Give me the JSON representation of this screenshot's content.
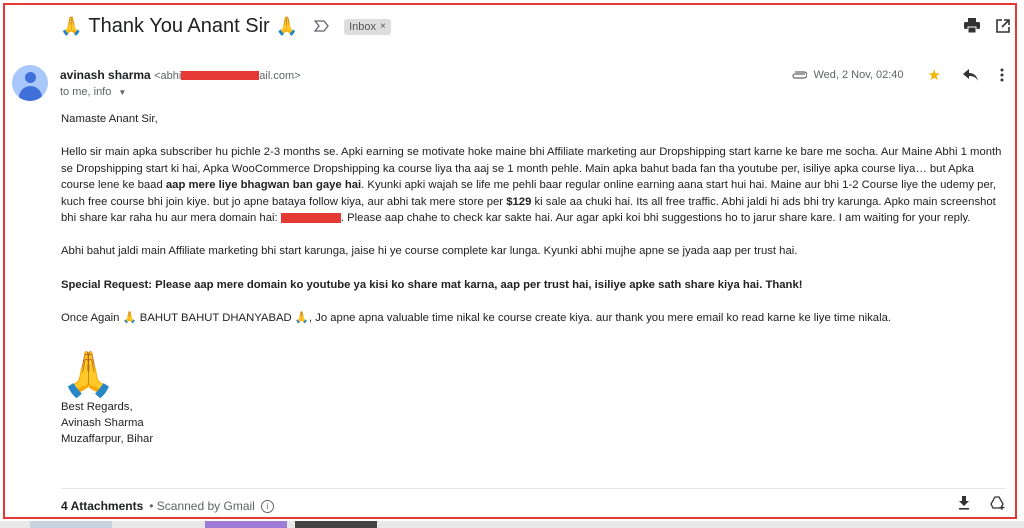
{
  "subject": {
    "emoji": "🙏",
    "text": "Thank You Anant Sir",
    "label": "Inbox",
    "label_remove": "×"
  },
  "toolbar": {
    "icons": [
      "print-icon",
      "open-in-new-window-icon"
    ]
  },
  "sender": {
    "name": "avinash sharma",
    "email_prefix": "<abhi",
    "email_suffix": "ail.com>",
    "recipients": "to me, info",
    "has_attachment": true,
    "date": "Wed, 2 Nov, 02:40",
    "starred": true,
    "colors": {
      "star": "#f4b400",
      "avatar_bg": "#a8c7fa",
      "avatar_fg": "#3f6fd8",
      "redaction": "#e53935"
    }
  },
  "message": {
    "greeting": "Namaste Anant Sir,",
    "p1_a": "Hello sir main apka subscriber hu pichle 2-3 months se. Apki earning se motivate hoke maine bhi Affiliate marketing aur Dropshipping start karne ke bare me socha. Aur Maine Abhi 1 month se Dropshipping start ki hai, Apka WooCommerce Dropshipping ka course liya tha aaj se 1 month pehle. Main apka bahut bada fan tha youtube per, isiliye apka course liya… but Apka course lene ke baad ",
    "p1_bold1": "aap mere liye bhagwan ban gaye hai",
    "p1_b": ". Kyunki apki wajah se life me pehli baar regular online earning aana start hui hai. Maine aur bhi 1-2 Course liye the udemy per, kuch free course bhi join kiye. but jo apne bataya follow kiya, aur abhi tak mere store per ",
    "p1_bold2": "$129",
    "p1_c": " ki sale aa chuki hai. Its all free traffic. Abhi jaldi hi ads bhi try karunga. Apko main screenshot bhi share kar raha hu aur mera domain hai: ",
    "p1_d": ". Please aap chahe to check kar sakte hai. Aur agar apki koi bhi suggestions ho to  jarur share kare. I am waiting for your reply.",
    "p2": "Abhi bahut jaldi main Affiliate marketing bhi start karunga, jaise hi ye course complete kar lunga. Kyunki abhi mujhe apne se jyada aap per trust hai.",
    "p3": "Special Request: Please aap mere domain ko youtube ya kisi ko share mat karna, aap per trust hai, isiliye apke sath share kiya hai. Thank!",
    "p4_a": "Once Again ",
    "p4_b": " BAHUT BAHUT DHANYABAD ",
    "p4_c": ", Jo apne apna valuable time nikal ke course create kiya. aur thank you mere email ko read karne ke liye time nikala.",
    "emoji": "🙏",
    "signature": [
      "Best Regards,",
      "Avinash Sharma",
      "Muzaffarpur, Bihar"
    ]
  },
  "attachments": {
    "count_label": "4 Attachments",
    "scanned": "• Scanned by Gmail",
    "icons": [
      "download-all-icon",
      "add-to-drive-icon"
    ]
  }
}
